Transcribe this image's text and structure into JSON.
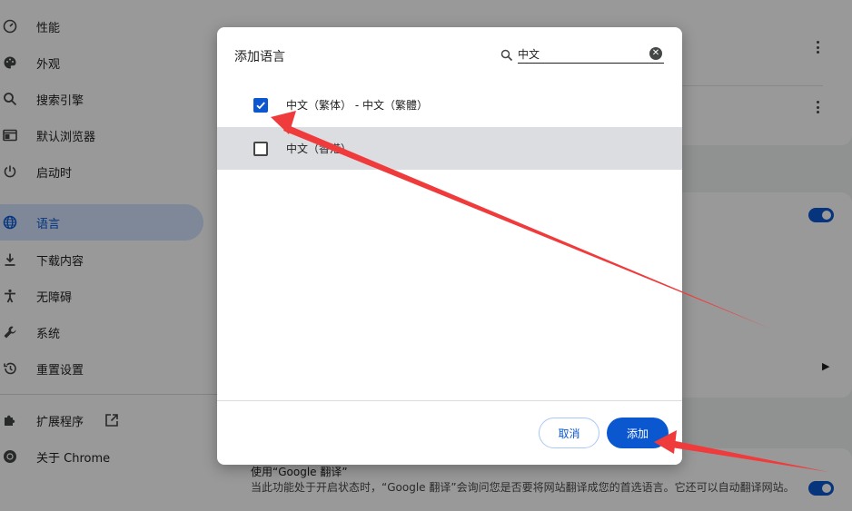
{
  "sidebar": {
    "items": [
      {
        "label": "性能",
        "icon": "speedometer-icon",
        "active": false
      },
      {
        "label": "外观",
        "icon": "palette-icon",
        "active": false
      },
      {
        "label": "搜索引擎",
        "icon": "search-icon",
        "active": false
      },
      {
        "label": "默认浏览器",
        "icon": "browser-window-icon",
        "active": false
      },
      {
        "label": "启动时",
        "icon": "power-icon",
        "active": false
      },
      {
        "label": "语言",
        "icon": "globe-icon",
        "active": true
      },
      {
        "label": "下载内容",
        "icon": "download-icon",
        "active": false
      },
      {
        "label": "无障碍",
        "icon": "accessibility-icon",
        "active": false
      },
      {
        "label": "系统",
        "icon": "wrench-icon",
        "active": false
      },
      {
        "label": "重置设置",
        "icon": "reset-history-icon",
        "active": false
      },
      {
        "label": "扩展程序",
        "icon": "puzzle-icon",
        "active": false
      },
      {
        "label": "关于 Chrome",
        "icon": "chrome-logo-icon",
        "active": false
      }
    ]
  },
  "background": {
    "translate_title": "使用“Google 翻译”",
    "translate_desc": "当此功能处于开启状态时，“Google 翻译”会询问您是否要将网站翻译成您的首选语言。它还可以自动翻译网站。"
  },
  "dialog": {
    "title": "添加语言",
    "search_value": "中文",
    "options": [
      {
        "label": "中文（繁体） - 中文（繁體）",
        "checked": true
      },
      {
        "label": "中文（香港）",
        "checked": false
      }
    ],
    "cancel_label": "取消",
    "add_label": "添加"
  },
  "colors": {
    "accent": "#0b57d0",
    "annotation_arrow": "#ef3b3b"
  }
}
